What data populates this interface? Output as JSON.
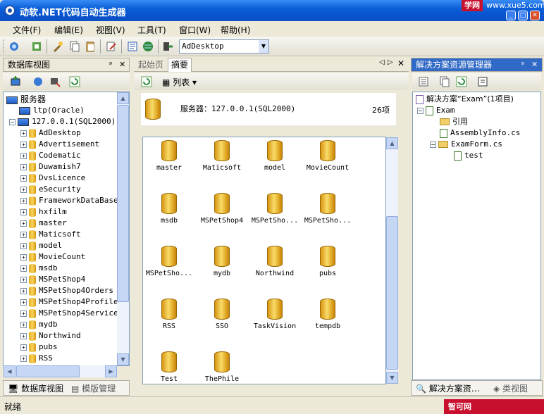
{
  "window": {
    "title": "动软.NET代码自动生成器",
    "watermark_top_a": "学网",
    "watermark_top_b": "www.xue5.com"
  },
  "menu": [
    "文件(F)",
    "编辑(E)",
    "视图(V)",
    "工具(T)",
    "窗口(W)",
    "帮助(H)"
  ],
  "toolbar": {
    "combo_value": "AdDesktop"
  },
  "left_panel": {
    "title": "数据库视图",
    "root": "服务器",
    "servers": [
      "ltp(Oracle)",
      "127.0.0.1(SQL2000)"
    ],
    "databases": [
      "AdDesktop",
      "Advertisement",
      "Codematic",
      "Duwamish7",
      "DvsLicence",
      "eSecurity",
      "FrameworkDataBase",
      "hxfilm",
      "master",
      "Maticsoft",
      "model",
      "MovieCount",
      "msdb",
      "MSPetShop4",
      "MSPetShop4Orders",
      "MSPetShop4Profile",
      "MSPetShop4Services",
      "mydb",
      "Northwind",
      "pubs",
      "RSS"
    ],
    "tabs": [
      "数据库视图",
      "模版管理"
    ]
  },
  "center": {
    "tabs": [
      "起始页",
      "摘要"
    ],
    "view_label": "列表",
    "server_label": "服务器：127.0.0.1(SQL2000)",
    "count_label": "26项",
    "items": [
      "master",
      "Maticsoft",
      "model",
      "MovieCount",
      "msdb",
      "MSPetShop4",
      "MSPetSho...",
      "MSPetSho...",
      "MSPetSho...",
      "mydb",
      "Northwind",
      "pubs",
      "RSS",
      "SSO",
      "TaskVision",
      "tempdb",
      "Test",
      "ThePhile"
    ]
  },
  "right_panel": {
    "title": "解决方案资源管理器",
    "solution": "解决方案“Exam”(1项目)",
    "project": "Exam",
    "items": [
      "引用",
      "AssemblyInfo.cs",
      "ExamForm.cs",
      "test"
    ],
    "tabs": [
      "解决方案资…",
      "类视图"
    ]
  },
  "status": {
    "text": "就绪",
    "watermark": "智可网 www.hzhike.com"
  }
}
